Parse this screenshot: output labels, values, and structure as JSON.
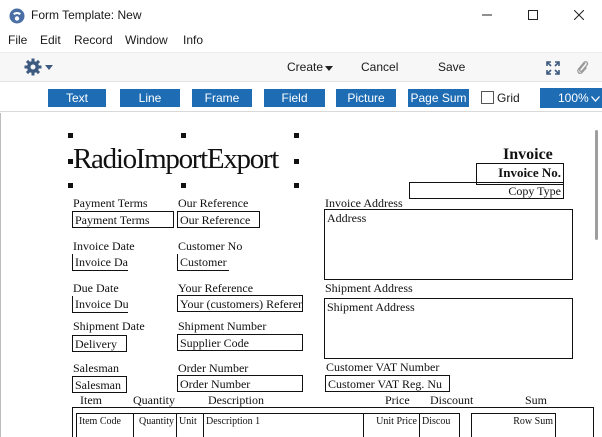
{
  "window": {
    "title": "Form Template: New"
  },
  "menu": [
    "File",
    "Edit",
    "Record",
    "Window",
    "Info"
  ],
  "toolbar": {
    "create": "Create",
    "cancel": "Cancel",
    "save": "Save"
  },
  "palette": {
    "buttons": [
      "Text",
      "Line",
      "Frame",
      "Field",
      "Picture",
      "Page Sum"
    ],
    "grid_label": "Grid",
    "zoom": "100%"
  },
  "colors": {
    "accent": "#1e6cb4"
  },
  "form": {
    "logo": "RadioImportExport",
    "invoice_title": "Invoice",
    "invoice_no": "Invoice No.",
    "copy_type": "Copy Type",
    "payment_terms_label": "Payment Terms",
    "payment_terms_field": "Payment Terms",
    "our_reference_label": "Our Reference",
    "our_reference_field": "Our Reference",
    "invoice_address_label": "Invoice Address",
    "invoice_address_field": "Address",
    "invoice_date_label": "Invoice Date",
    "invoice_date_field": "Invoice Da",
    "customer_no_label": "Customer No",
    "customer_no_field": "Customer",
    "due_date_label": "Due Date",
    "due_date_field": "Invoice Du",
    "your_reference_label": "Your Reference",
    "your_reference_field": "Your (customers) Referen",
    "shipment_address_label": "Shipment Address",
    "shipment_address_field": "Shipment Address",
    "shipment_date_label": "Shipment Date",
    "shipment_date_field": "Delivery",
    "shipment_number_label": "Shipment Number",
    "shipment_number_field": "Supplier Code",
    "salesman_label": "Salesman",
    "salesman_field": "Salesman",
    "order_number_label": "Order Number",
    "order_number_field": "Order Number",
    "vat_label": "Customer VAT Number",
    "vat_field": "Customer VAT Reg. Nu",
    "columns": [
      "Item",
      "Quantity",
      "Description",
      "Price",
      "Discount",
      "Sum"
    ],
    "row_fields": [
      "Item Code",
      "Quantity",
      "Unit",
      "Description 1",
      "Unit Price",
      "Discou",
      "Row Sum"
    ]
  }
}
